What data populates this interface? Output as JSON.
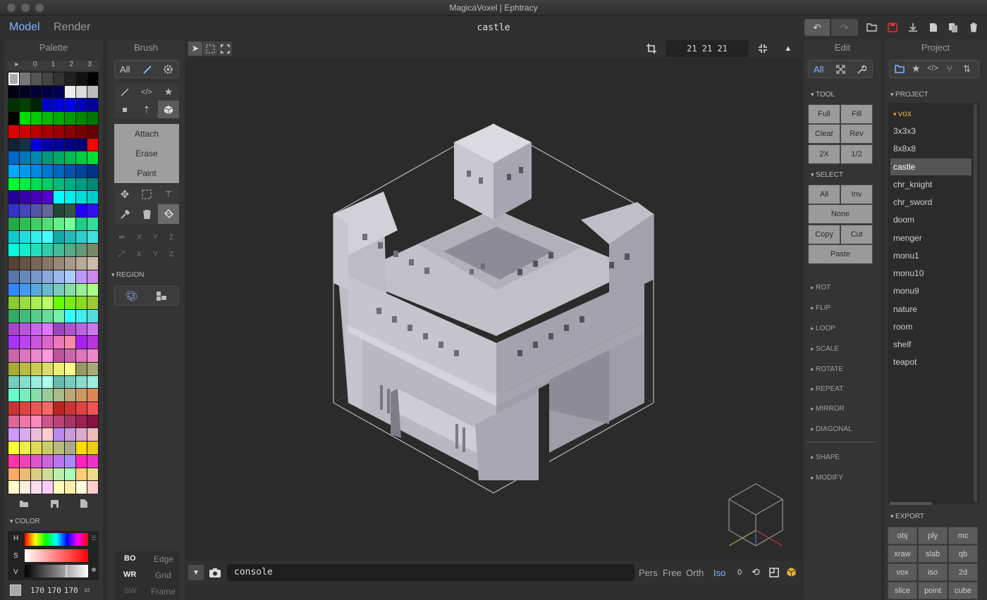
{
  "window": {
    "title": "MagicaVoxel | Ephtracy"
  },
  "menubar": {
    "mode_model": "Model",
    "mode_render": "Render",
    "file_name": "castle"
  },
  "palette": {
    "title": "Palette",
    "tabs": [
      "▸",
      "0",
      "1",
      "2",
      "3"
    ],
    "color_section": "COLOR",
    "hsv_labels": [
      "H",
      "S",
      "V"
    ],
    "rgb": [
      "170",
      "170",
      "170"
    ]
  },
  "brush": {
    "title": "Brush",
    "filter": "All",
    "modes": [
      "Attach",
      "Erase",
      "Paint"
    ],
    "axis_labels": [
      "X",
      "Y",
      "Z"
    ],
    "region_section": "REGION",
    "render_opts": [
      [
        "BO",
        "Edge"
      ],
      [
        "WR",
        "Grid"
      ],
      [
        "SW",
        "Frame"
      ]
    ]
  },
  "viewport": {
    "dims": "21 21 21",
    "console": "console",
    "views": [
      "Pers",
      "Free",
      "Orth",
      "Iso"
    ],
    "zero": "0"
  },
  "edit": {
    "title": "Edit",
    "filter": "All",
    "tool_section": "TOOL",
    "tool_buttons": [
      "Full",
      "Fill",
      "Clear",
      "Rev",
      "2X",
      "1/2"
    ],
    "select_section": "SELECT",
    "select_buttons": [
      "All",
      "Inv",
      "None",
      "Copy",
      "Cut",
      "Paste"
    ],
    "collapsed_sections": [
      "ROT",
      "FLIP",
      "LOOP",
      "SCALE",
      "ROTATE",
      "REPEAT",
      "MIRROR",
      "DIAGONAL"
    ],
    "collapsed_sections2": [
      "SHAPE",
      "MODIFY"
    ]
  },
  "project": {
    "title": "Project",
    "section": "PROJECT",
    "folder": "vox",
    "files": [
      "3x3x3",
      "8x8x8",
      "castle",
      "chr_knight",
      "chr_sword",
      "doom",
      "menger",
      "monu1",
      "monu10",
      "monu9",
      "nature",
      "room",
      "shelf",
      "teapot"
    ],
    "selected": "castle",
    "export_section": "EXPORT",
    "export_buttons": [
      "obj",
      "ply",
      "mc",
      "xraw",
      "slab",
      "qb",
      "vox",
      "iso",
      "2d",
      "slice",
      "point",
      "cube"
    ]
  },
  "colors": {
    "accent": "#7fb7ff",
    "folder": "#e0b040",
    "save": "#e03030"
  }
}
